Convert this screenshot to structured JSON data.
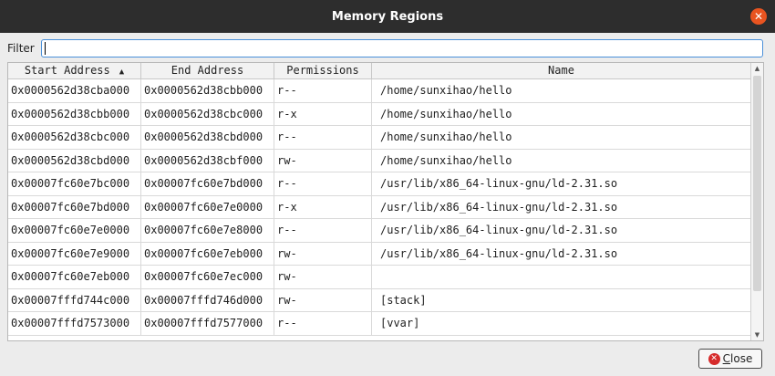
{
  "window": {
    "title": "Memory Regions"
  },
  "filter": {
    "label": "Filter",
    "value": ""
  },
  "table": {
    "columns": [
      "Start Address",
      "End Address",
      "Permissions",
      "Name"
    ],
    "sort_indicator": "▲",
    "rows": [
      [
        "0x0000562d38cba000",
        "0x0000562d38cbb000",
        "r--",
        "/home/sunxihao/hello"
      ],
      [
        "0x0000562d38cbb000",
        "0x0000562d38cbc000",
        "r-x",
        "/home/sunxihao/hello"
      ],
      [
        "0x0000562d38cbc000",
        "0x0000562d38cbd000",
        "r--",
        "/home/sunxihao/hello"
      ],
      [
        "0x0000562d38cbd000",
        "0x0000562d38cbf000",
        "rw-",
        "/home/sunxihao/hello"
      ],
      [
        "0x00007fc60e7bc000",
        "0x00007fc60e7bd000",
        "r--",
        "/usr/lib/x86_64-linux-gnu/ld-2.31.so"
      ],
      [
        "0x00007fc60e7bd000",
        "0x00007fc60e7e0000",
        "r-x",
        "/usr/lib/x86_64-linux-gnu/ld-2.31.so"
      ],
      [
        "0x00007fc60e7e0000",
        "0x00007fc60e7e8000",
        "r--",
        "/usr/lib/x86_64-linux-gnu/ld-2.31.so"
      ],
      [
        "0x00007fc60e7e9000",
        "0x00007fc60e7eb000",
        "rw-",
        "/usr/lib/x86_64-linux-gnu/ld-2.31.so"
      ],
      [
        "0x00007fc60e7eb000",
        "0x00007fc60e7ec000",
        "rw-",
        ""
      ],
      [
        "0x00007fffd744c000",
        "0x00007fffd746d000",
        "rw-",
        "[stack]"
      ],
      [
        "0x00007fffd7573000",
        "0x00007fffd7577000",
        "r--",
        "[vvar]"
      ]
    ]
  },
  "buttons": {
    "close_prefix": "",
    "close_mnemonic": "C",
    "close_rest": "lose"
  },
  "icons": {
    "window_close": "close-icon",
    "button_close": "close-circle-icon"
  },
  "colors": {
    "titlebar": "#2d2d2d",
    "window_close": "#e95420",
    "focus": "#4a90d9"
  }
}
